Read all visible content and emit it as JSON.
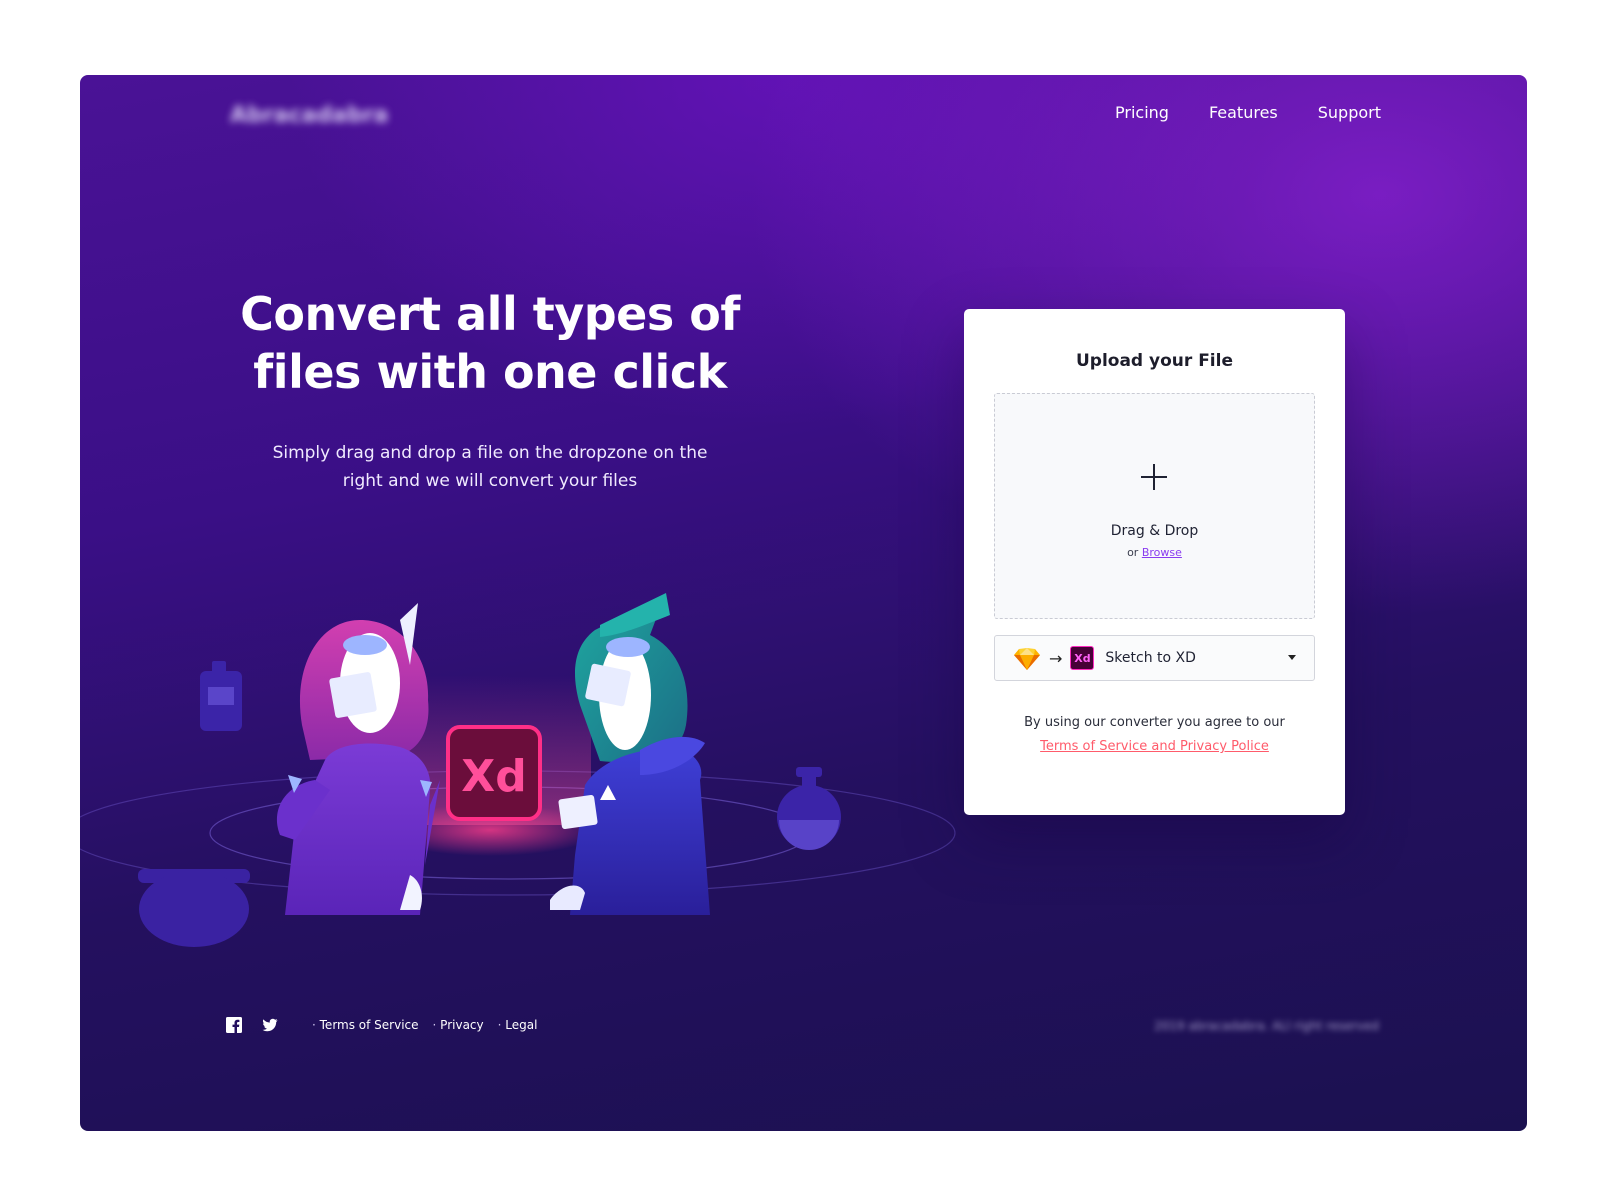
{
  "header": {
    "logo_text": "Abracadabra",
    "nav": [
      "Pricing",
      "Features",
      "Support"
    ]
  },
  "hero": {
    "title_line1": "Convert all types of",
    "title_line2": "files with one click",
    "subtitle": "Simply drag and drop a file on the dropzone on the right and we will convert your files"
  },
  "upload": {
    "title": "Upload your File",
    "drop_label": "Drag & Drop",
    "or_text": "or",
    "browse_label": "Browse",
    "conversion": {
      "from_icon": "sketch-icon",
      "to_icon": "xd-icon",
      "arrow": "→",
      "xd_badge": "Xd",
      "selected": "Sketch to XD"
    },
    "agree_text": "By using our converter you agree to our",
    "terms_link": "Terms of Service and Privacy Police"
  },
  "illustration": {
    "xd_badge": "Xd"
  },
  "footer": {
    "links": [
      "Terms of Service",
      "Privacy",
      "Legal"
    ],
    "copyright": "2019 abracadabra. ALl right reserved"
  },
  "colors": {
    "primary_purple": "#6a12c9",
    "link_purple": "#8a3cf0",
    "terms_red": "#ff5b6b",
    "xd_pink": "#ff2bc2",
    "dark_navy": "#1b1150"
  }
}
